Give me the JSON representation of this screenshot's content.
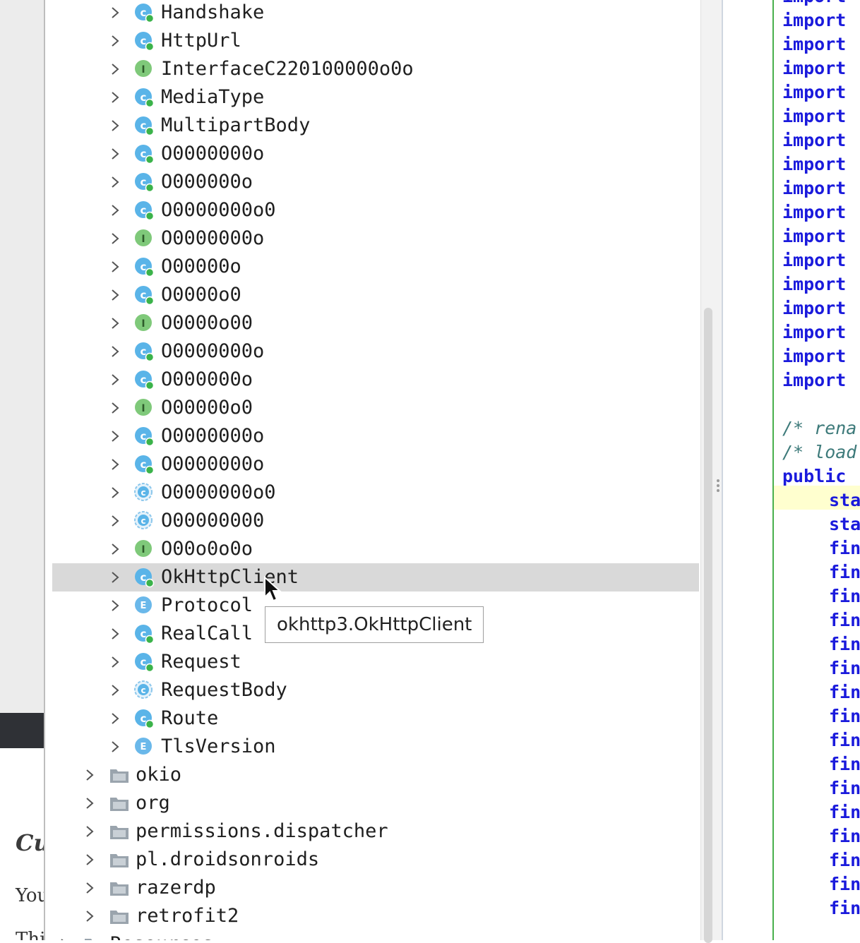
{
  "background_page": {
    "heading": "Cu",
    "line1": "You",
    "line2": "Thi"
  },
  "tree": {
    "items": [
      {
        "label": "Handshake",
        "icon": "class-icon",
        "kind": "class"
      },
      {
        "label": "HttpUrl",
        "icon": "class-icon",
        "kind": "class"
      },
      {
        "label": "InterfaceC220100000o0o",
        "icon": "interface-icon",
        "kind": "interface"
      },
      {
        "label": "MediaType",
        "icon": "class-icon",
        "kind": "class"
      },
      {
        "label": "MultipartBody",
        "icon": "class-icon",
        "kind": "class"
      },
      {
        "label": "O0000000o",
        "icon": "class-icon",
        "kind": "class"
      },
      {
        "label": "O000000o",
        "icon": "class-icon",
        "kind": "class"
      },
      {
        "label": "O0000000o0",
        "icon": "class-icon",
        "kind": "class"
      },
      {
        "label": "O0000000o",
        "icon": "interface-icon",
        "kind": "interface"
      },
      {
        "label": "O00000o",
        "icon": "class-icon",
        "kind": "class"
      },
      {
        "label": "O0000o0",
        "icon": "class-icon",
        "kind": "class"
      },
      {
        "label": "O0000o00",
        "icon": "interface-icon",
        "kind": "interface"
      },
      {
        "label": "O0000000o",
        "icon": "class-icon",
        "kind": "class"
      },
      {
        "label": "O000000o",
        "icon": "class-icon",
        "kind": "class"
      },
      {
        "label": "O00000o0",
        "icon": "interface-icon",
        "kind": "interface"
      },
      {
        "label": "O0000000o",
        "icon": "class-icon",
        "kind": "class"
      },
      {
        "label": "O0000000o",
        "icon": "class-icon",
        "kind": "class"
      },
      {
        "label": "O0000000o0",
        "icon": "abstract-class-icon",
        "kind": "abstract"
      },
      {
        "label": "O00000000",
        "icon": "abstract-class-icon",
        "kind": "abstract"
      },
      {
        "label": "O00o0o0o",
        "icon": "interface-icon",
        "kind": "interface"
      },
      {
        "label": "OkHttpClient",
        "icon": "class-icon",
        "kind": "class",
        "selected": true
      },
      {
        "label": "Protocol",
        "icon": "enum-icon",
        "kind": "enum"
      },
      {
        "label": "RealCall",
        "icon": "class-icon",
        "kind": "class"
      },
      {
        "label": "Request",
        "icon": "class-icon",
        "kind": "class"
      },
      {
        "label": "RequestBody",
        "icon": "abstract-class-icon",
        "kind": "abstract"
      },
      {
        "label": "Route",
        "icon": "class-icon",
        "kind": "class"
      },
      {
        "label": "TlsVersion",
        "icon": "enum-icon",
        "kind": "enum"
      }
    ],
    "packages": [
      {
        "label": "okio",
        "icon": "package-icon"
      },
      {
        "label": "org",
        "icon": "package-icon"
      },
      {
        "label": "permissions.dispatcher",
        "icon": "package-icon"
      },
      {
        "label": "pl.droidsonroids",
        "icon": "package-icon"
      },
      {
        "label": "razerdp",
        "icon": "package-icon"
      },
      {
        "label": "retrofit2",
        "icon": "package-icon"
      }
    ],
    "root_item": {
      "label": "Resources",
      "icon": "folder-icon"
    }
  },
  "tooltip": {
    "text": "okhttp3.OkHttpClient"
  },
  "code": {
    "lines": [
      {
        "text": "import",
        "type": "keyword"
      },
      {
        "text": "import",
        "type": "keyword"
      },
      {
        "text": "import",
        "type": "keyword"
      },
      {
        "text": "import",
        "type": "keyword"
      },
      {
        "text": "import",
        "type": "keyword"
      },
      {
        "text": "import",
        "type": "keyword"
      },
      {
        "text": "import",
        "type": "keyword"
      },
      {
        "text": "import",
        "type": "keyword"
      },
      {
        "text": "import",
        "type": "keyword"
      },
      {
        "text": "import",
        "type": "keyword"
      },
      {
        "text": "import",
        "type": "keyword"
      },
      {
        "text": "import",
        "type": "keyword"
      },
      {
        "text": "import",
        "type": "keyword"
      },
      {
        "text": "import",
        "type": "keyword"
      },
      {
        "text": "import",
        "type": "keyword"
      },
      {
        "text": "import",
        "type": "keyword"
      },
      {
        "text": "import",
        "type": "keyword"
      },
      {
        "text": "",
        "type": "blank"
      },
      {
        "text": "/* rena",
        "type": "comment"
      },
      {
        "text": "/* load",
        "type": "comment"
      },
      {
        "text": "public",
        "type": "keyword"
      },
      {
        "text": "sta",
        "type": "indent"
      },
      {
        "text": "sta",
        "type": "indent"
      },
      {
        "text": "fin",
        "type": "indent"
      },
      {
        "text": "fin",
        "type": "indent"
      },
      {
        "text": "fin",
        "type": "indent"
      },
      {
        "text": "fin",
        "type": "indent"
      },
      {
        "text": "fin",
        "type": "indent"
      },
      {
        "text": "fin",
        "type": "indent"
      },
      {
        "text": "fin",
        "type": "indent"
      },
      {
        "text": "fin",
        "type": "indent"
      },
      {
        "text": "fin",
        "type": "indent"
      },
      {
        "text": "fin",
        "type": "indent"
      },
      {
        "text": "fin",
        "type": "indent"
      },
      {
        "text": "fin",
        "type": "indent"
      },
      {
        "text": "fin",
        "type": "indent"
      },
      {
        "text": "fin",
        "type": "indent"
      },
      {
        "text": "fin",
        "type": "indent"
      },
      {
        "text": "fin",
        "type": "indent"
      }
    ]
  },
  "colors": {
    "class_icon": "#5ab4e8",
    "interface_icon": "#7fc97a",
    "enum_icon": "#6ab8ea",
    "badge_green": "#3bb34a",
    "keyword_blue": "#1a1adc",
    "selection": "#d9d9d9",
    "current_line": "#ffffcf"
  }
}
